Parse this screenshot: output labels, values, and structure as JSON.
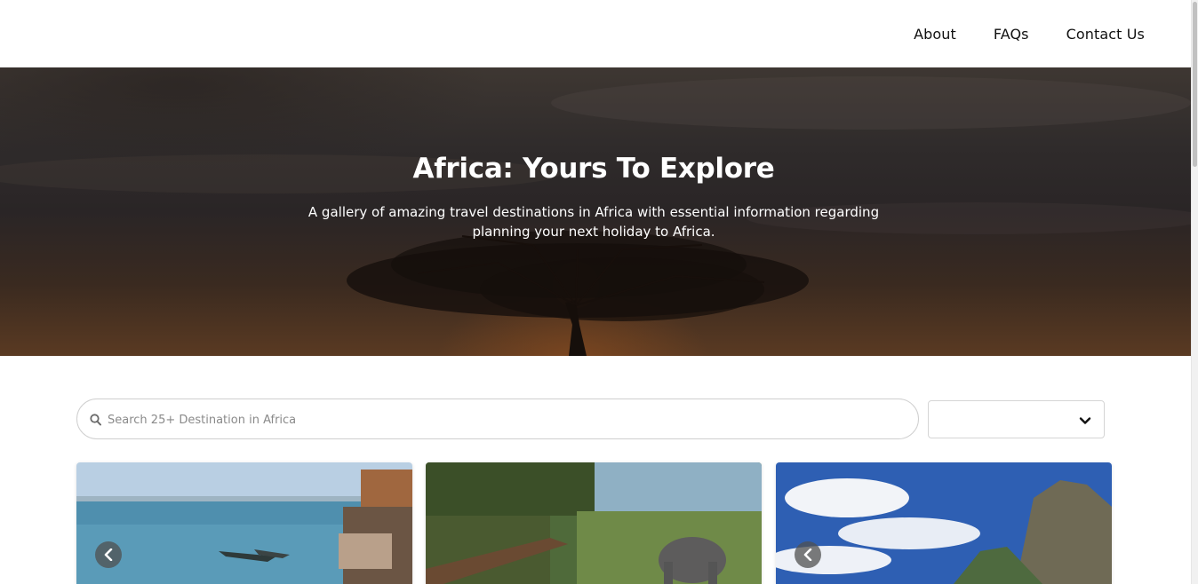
{
  "nav": {
    "items": [
      {
        "label": "About"
      },
      {
        "label": "FAQs"
      },
      {
        "label": "Contact Us"
      }
    ]
  },
  "hero": {
    "title": "Africa: Yours To Explore",
    "subtitle": "A gallery of amazing travel destinations in Africa with essential information regarding planning your next holiday to Africa."
  },
  "search": {
    "placeholder": "Search 25+ Destination in Africa",
    "value": "",
    "icon": "search-icon"
  },
  "filter": {
    "selected": "",
    "icon": "chevron-down-icon"
  },
  "cards": [
    {
      "image": "river-with-boats-and-houses",
      "nav_icon": "chevron-left-icon"
    },
    {
      "image": "safari-lodge-deck-with-elephant"
    },
    {
      "image": "rocky-outcrop-under-blue-sky",
      "nav_icon": "chevron-left-icon"
    }
  ],
  "colors": {
    "text": "#111111",
    "hero_text": "#ffffff",
    "border": "#cfcfcf"
  }
}
